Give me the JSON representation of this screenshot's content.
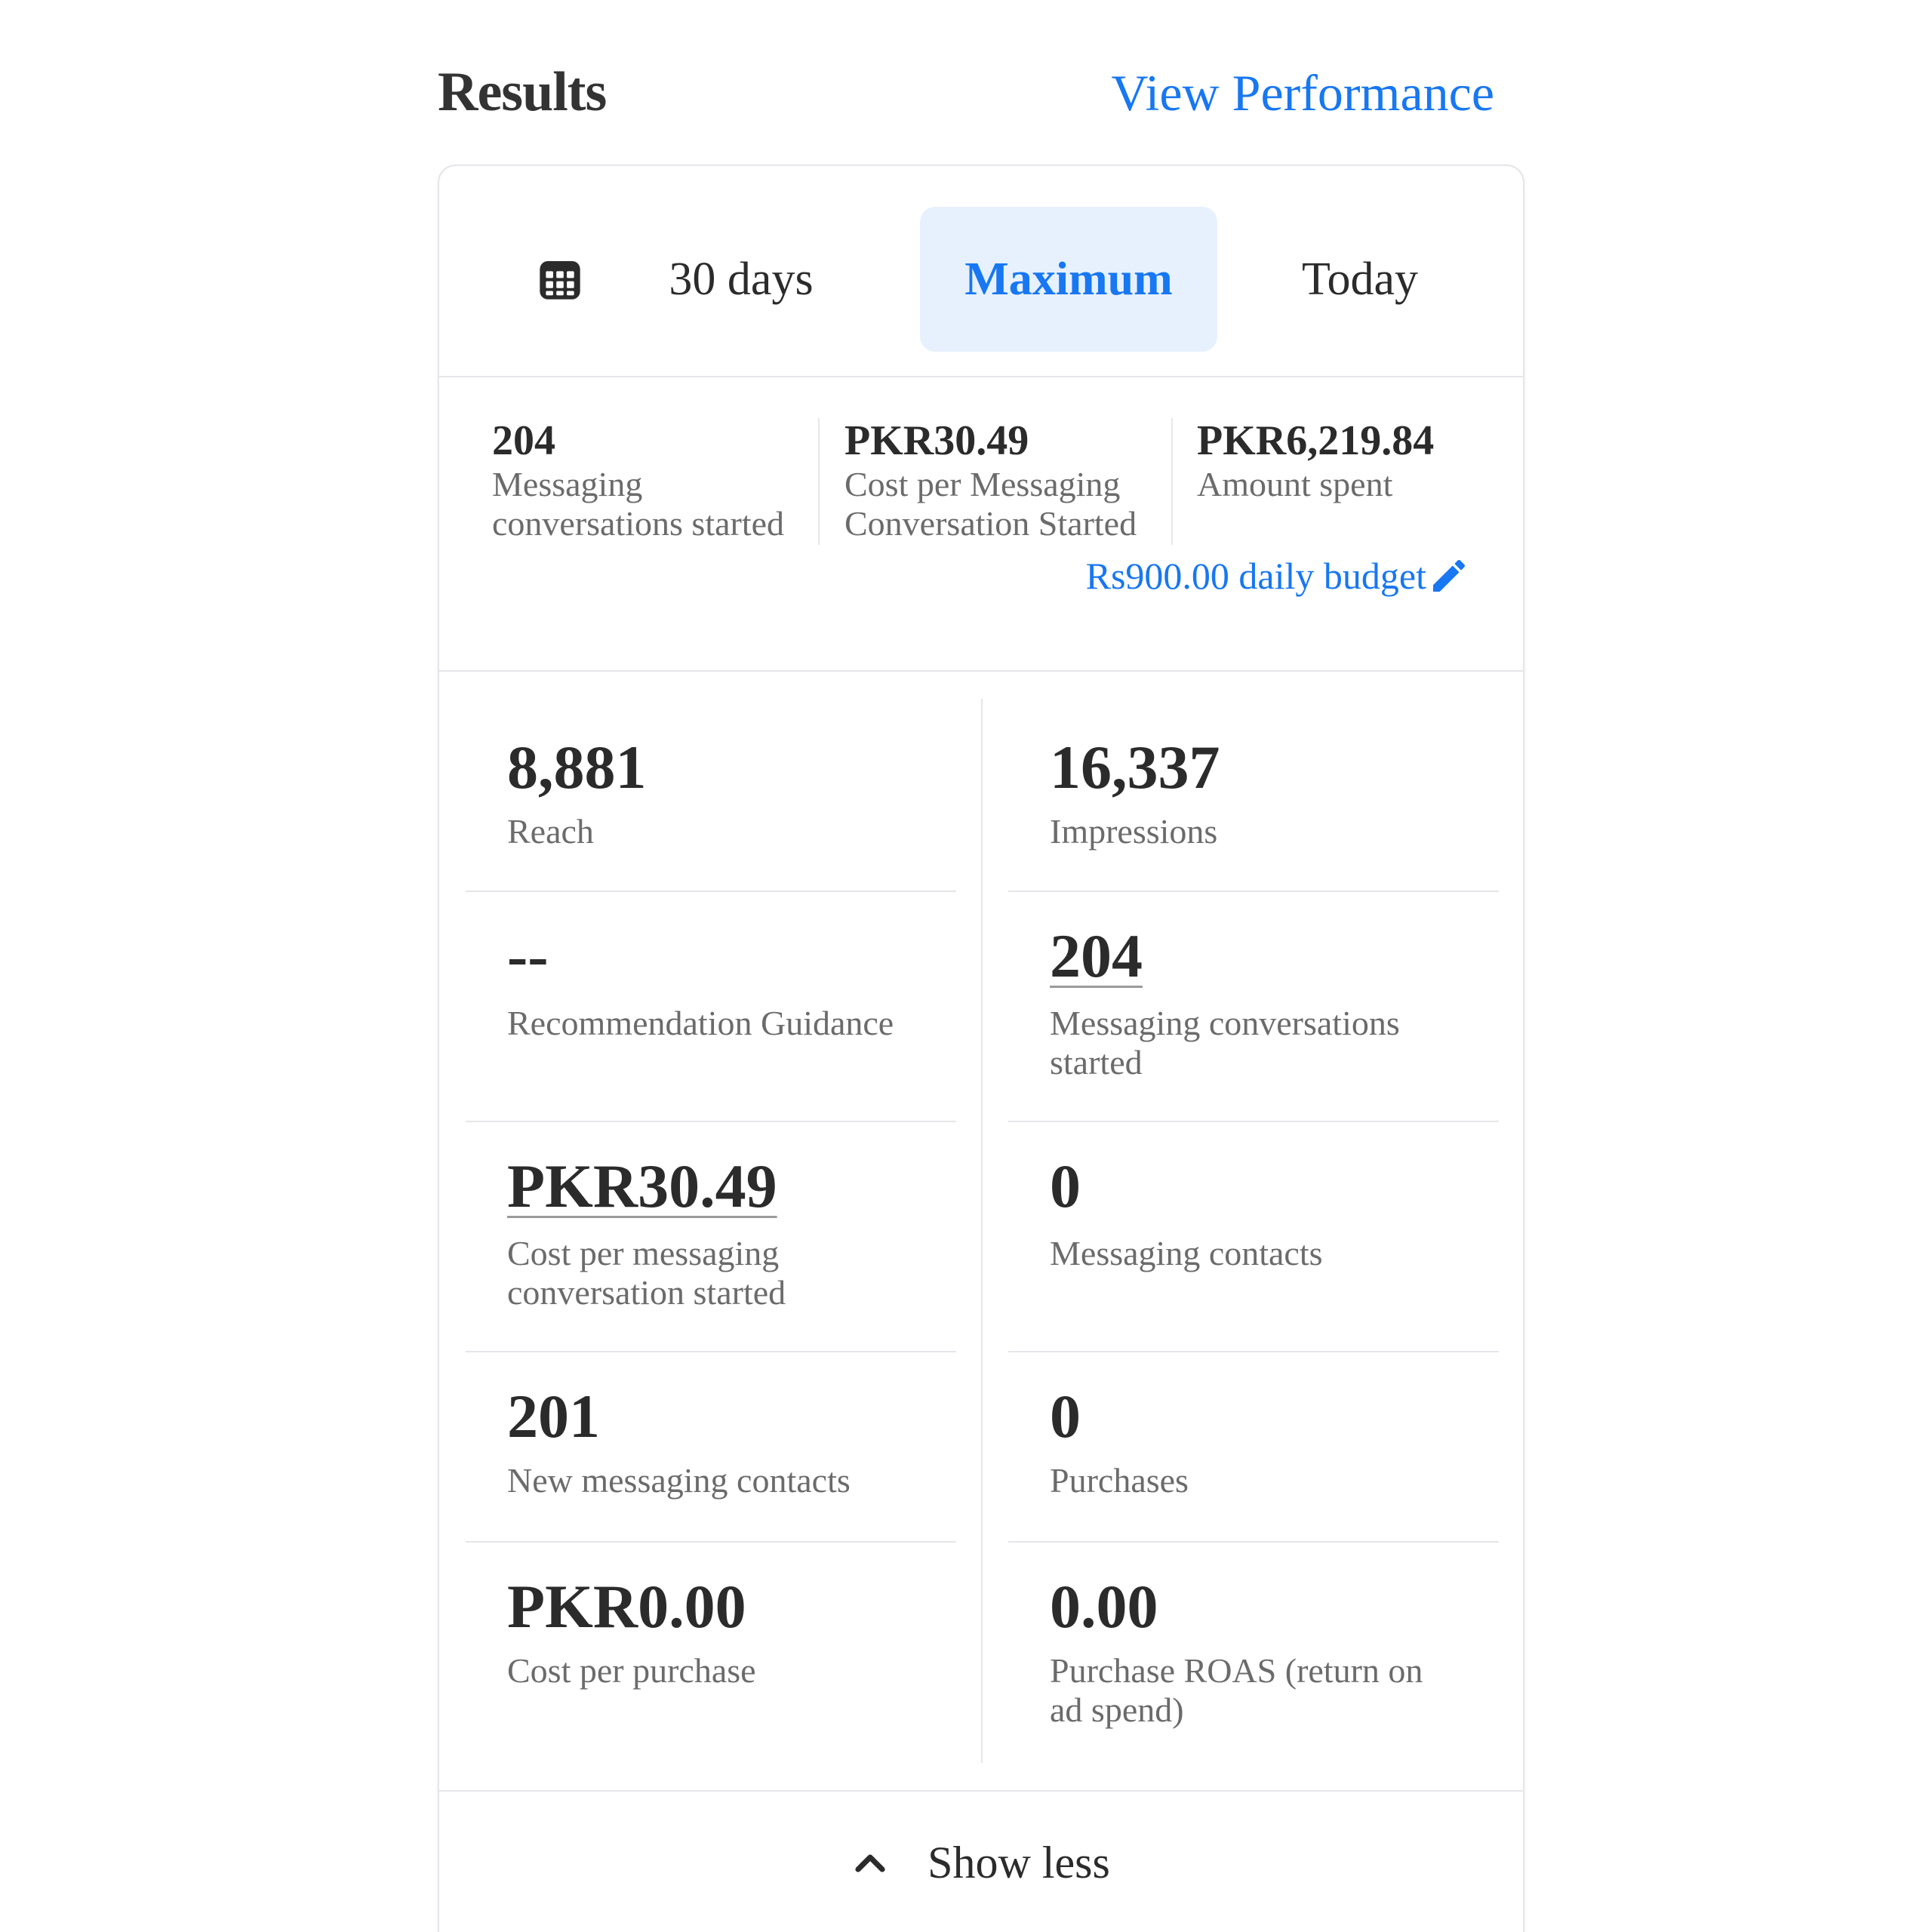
{
  "header": {
    "title": "Results",
    "view_link": "View Performance"
  },
  "tabs": {
    "calendar_icon": "calendar-grid-icon",
    "items": [
      {
        "label": "30 days",
        "selected": false
      },
      {
        "label": "Maximum",
        "selected": true
      },
      {
        "label": "Today",
        "selected": false
      }
    ]
  },
  "summary": {
    "items": [
      {
        "value": "204",
        "label_line1": "Messaging",
        "label_line2": "conversations started"
      },
      {
        "value": "PKR30.49",
        "label_line1": "Cost per Messaging",
        "label_line2": "Conversation Started"
      },
      {
        "value": "PKR6,219.84",
        "label_line1": "Amount spent",
        "label_line2": ""
      }
    ],
    "budget_link": "Rs900.00 daily budget",
    "budget_icon": "pencil-icon"
  },
  "metrics": [
    {
      "value": "8,881",
      "label": "Reach"
    },
    {
      "value": "16,337",
      "label": "Impressions"
    },
    {
      "value": "--",
      "label": "Recommendation Guidance"
    },
    {
      "value": "204",
      "label_line1": "Messaging conversations",
      "label_line2": "started"
    },
    {
      "value": "PKR30.49",
      "label_line1": "Cost per messaging",
      "label_line2": "conversation started"
    },
    {
      "value": "0",
      "label": "Messaging contacts"
    },
    {
      "value": "201",
      "label": "New messaging contacts"
    },
    {
      "value": "0",
      "label": "Purchases"
    },
    {
      "value": "PKR0.00",
      "label": "Cost per purchase"
    },
    {
      "value": "0.00",
      "label_line1": "Purchase ROAS (return on",
      "label_line2": "ad spend)"
    }
  ],
  "footer": {
    "show_less": "Show less",
    "icon": "chevron-up-icon"
  },
  "colors": {
    "accent": "#1877f2",
    "selected_tab_bg": "#e7f1fe",
    "divider": "#e4e6ea",
    "text_primary": "#2b2b2b",
    "text_secondary": "#6b6b6b"
  }
}
